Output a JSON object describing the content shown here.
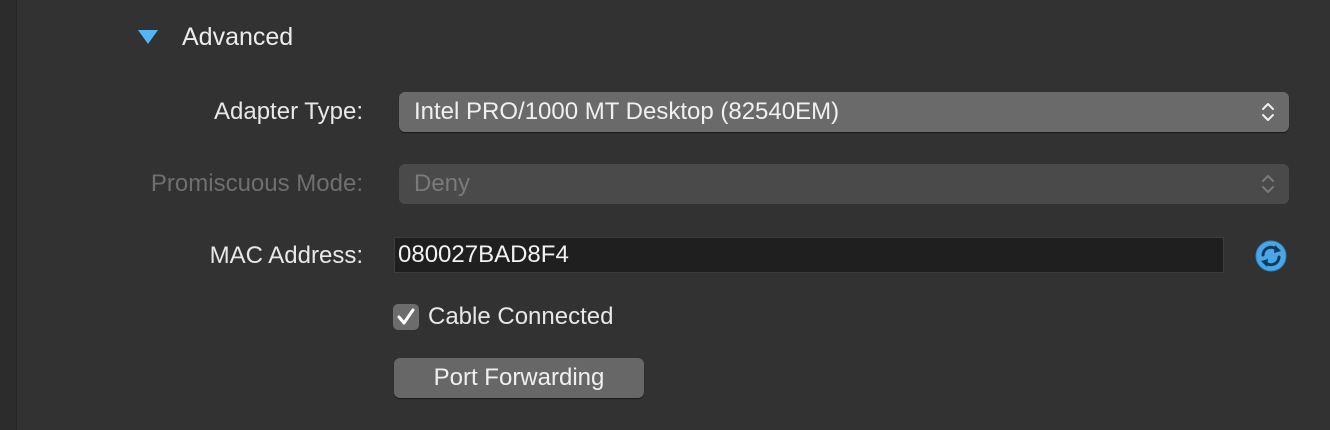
{
  "section": {
    "title": "Advanced",
    "expanded": true,
    "icon": "disclosure-triangle-down-icon"
  },
  "adapter_type": {
    "label": "Adapter Type:",
    "value": "Intel PRO/1000 MT Desktop (82540EM)"
  },
  "promiscuous_mode": {
    "label": "Promiscuous Mode:",
    "value": "Deny",
    "enabled": false
  },
  "mac_address": {
    "label": "MAC Address:",
    "value": "080027BAD8F4",
    "refresh_icon": "refresh-icon"
  },
  "cable_connected": {
    "label": "Cable Connected",
    "checked": true
  },
  "port_forwarding": {
    "label": "Port Forwarding"
  },
  "colors": {
    "accent": "#55b5f0",
    "background": "#323232",
    "field": "#1f1f1f"
  }
}
